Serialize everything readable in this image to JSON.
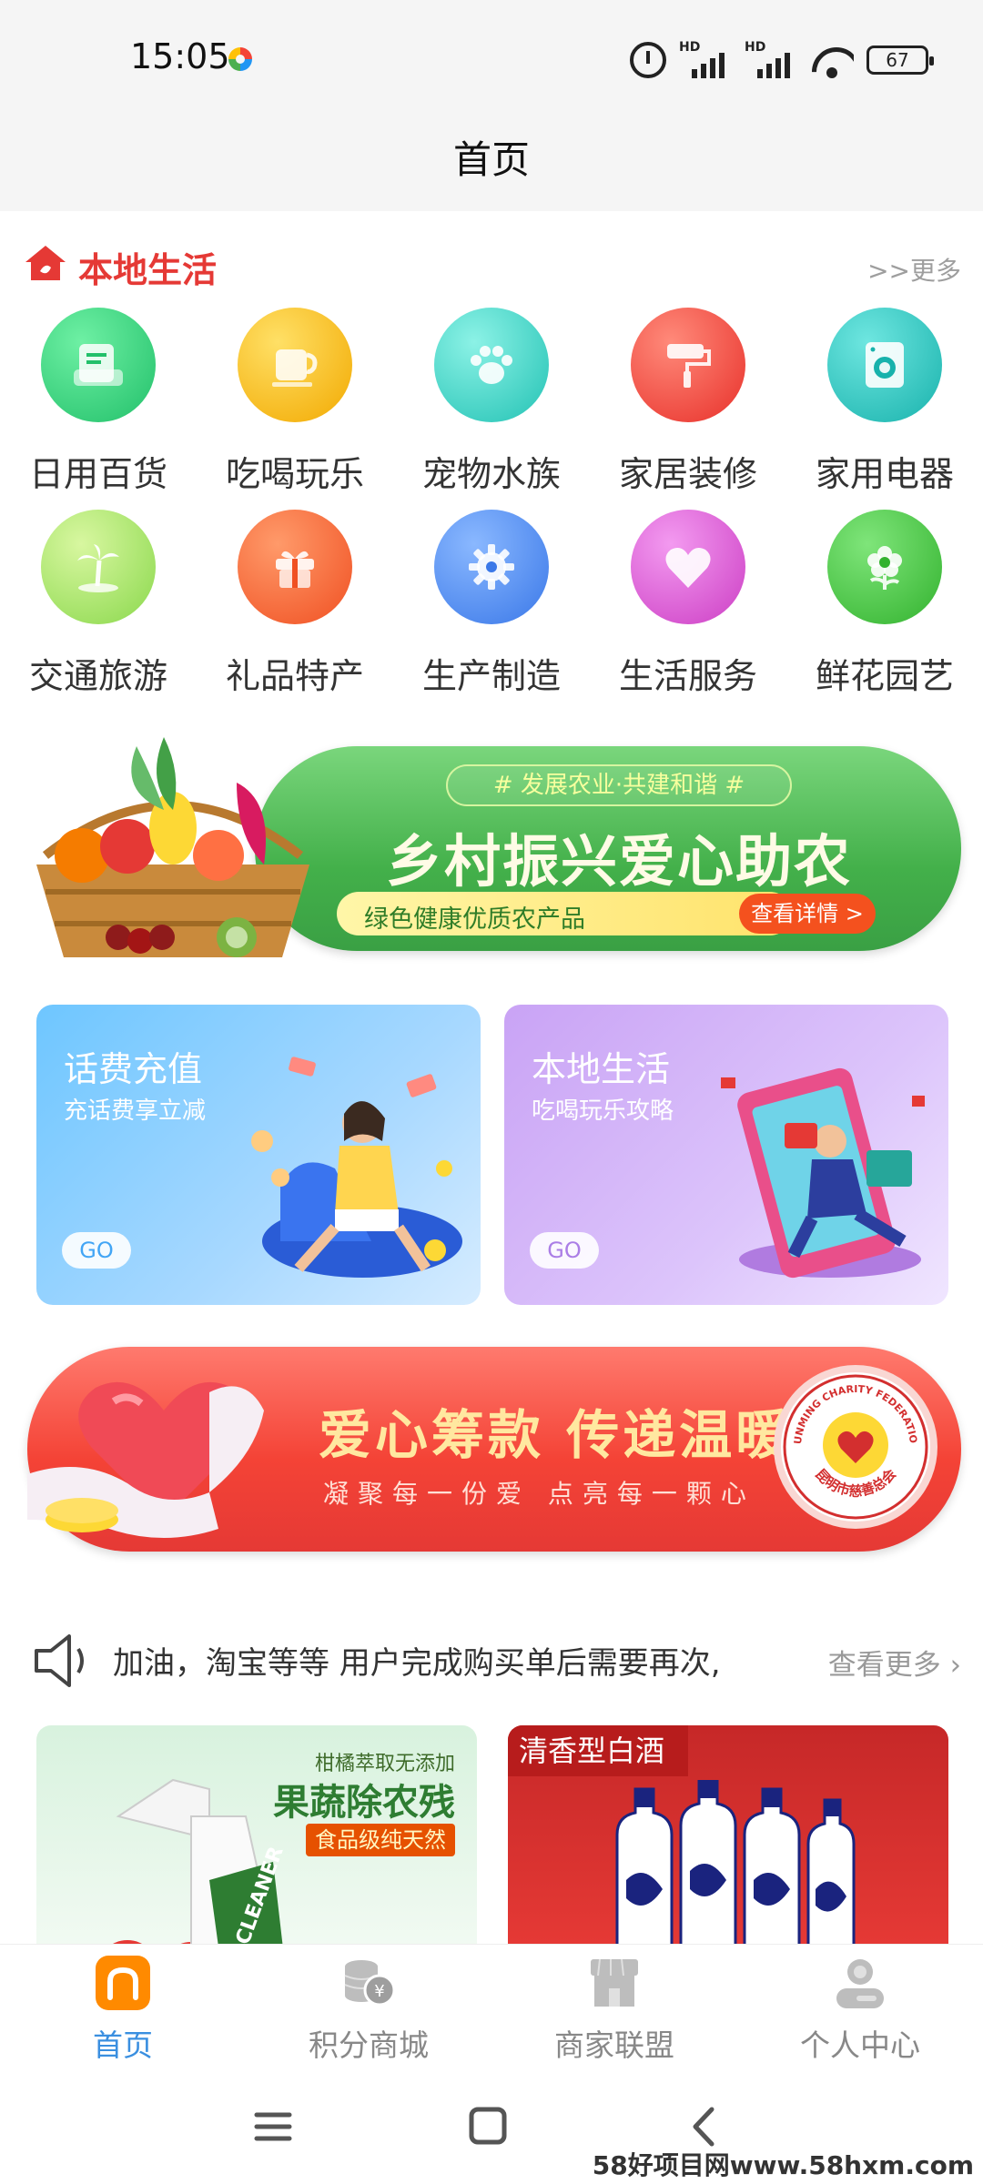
{
  "status_bar": {
    "time": "15:05",
    "network_label_1": "HD",
    "network_label_2": "HD",
    "battery": "67"
  },
  "header": {
    "title": "首页"
  },
  "local_life": {
    "title": "本地生活",
    "more": ">>更多",
    "categories": [
      {
        "label": "日用百货",
        "icon": "shopping-bag-icon",
        "color": "#2ecc71"
      },
      {
        "label": "吃喝玩乐",
        "icon": "cup-icon",
        "color": "#f5b800"
      },
      {
        "label": "宠物水族",
        "icon": "paw-icon",
        "color": "#3fd6c7"
      },
      {
        "label": "家居装修",
        "icon": "paint-roller-icon",
        "color": "#f44336"
      },
      {
        "label": "家用电器",
        "icon": "washing-machine-icon",
        "color": "#2bc5c0"
      },
      {
        "label": "交通旅游",
        "icon": "palm-tree-icon",
        "color": "#a8e86a"
      },
      {
        "label": "礼品特产",
        "icon": "gift-icon",
        "color": "#ff6a3d"
      },
      {
        "label": "生产制造",
        "icon": "gear-icon",
        "color": "#4a90f0"
      },
      {
        "label": "生活服务",
        "icon": "heart-icon",
        "color": "#e25ad8"
      },
      {
        "label": "鲜花园艺",
        "icon": "flower-icon",
        "color": "#4ccb4a"
      }
    ]
  },
  "farm_banner": {
    "tag": "# 发展农业·共建和谐 #",
    "title": "乡村振兴爱心助农",
    "subtitle": "绿色健康优质农产品",
    "button": "查看详情 >"
  },
  "promo_cards": [
    {
      "title": "话费充值",
      "subtitle": "充话费享立减",
      "button": "GO"
    },
    {
      "title": "本地生活",
      "subtitle": "吃喝玩乐攻略",
      "button": "GO"
    }
  ],
  "charity_banner": {
    "title": "爱心筹款 传递温暖",
    "subtitle": "凝聚每一份爱 点亮每一颗心",
    "seal_text_top": "KUNMING CHARITY FEDERATION",
    "seal_text_bottom": "昆明市慈善总会"
  },
  "notice": {
    "text": "加油，淘宝等等 用户完成购买单后需要再次,",
    "more": "查看更多"
  },
  "products": [
    {
      "caption": "柑橘萃取无添加",
      "title": "果蔬除农残",
      "badge": "食品级纯天然",
      "bottle_label": "CLEANER"
    },
    {
      "label": "清香型白酒"
    }
  ],
  "bottom_nav": [
    {
      "label": "首页",
      "icon": "home-icon",
      "active": true
    },
    {
      "label": "积分商城",
      "icon": "coins-icon",
      "active": false
    },
    {
      "label": "商家联盟",
      "icon": "storefront-icon",
      "active": false
    },
    {
      "label": "个人中心",
      "icon": "user-icon",
      "active": false
    }
  ],
  "watermark": "58好项目网www.58hxm.com",
  "colors": {
    "accent_red": "#e53935",
    "active_blue": "#3a8fe0",
    "home_icon_orange": "#ff8a00"
  }
}
